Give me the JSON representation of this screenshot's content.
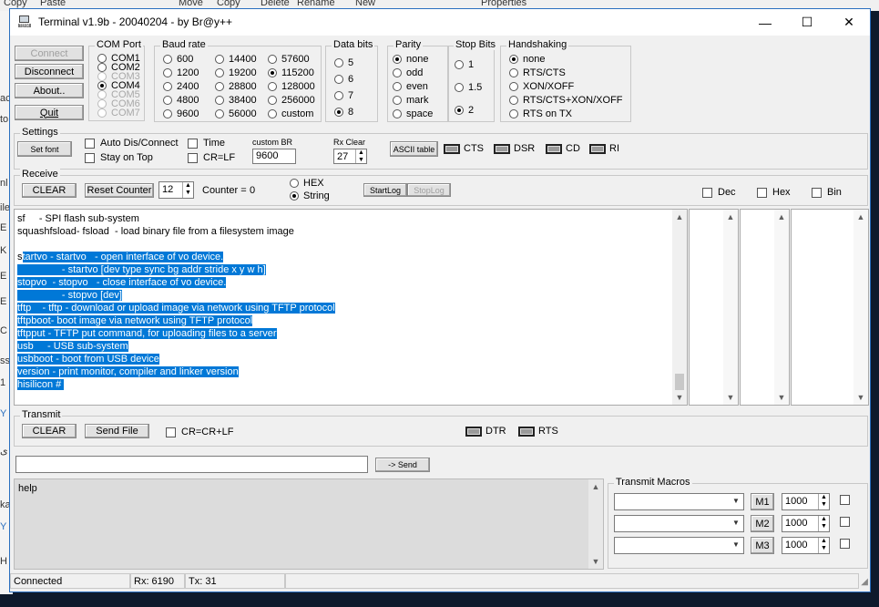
{
  "background": {
    "explorer_labels": [
      "Copy",
      "Paste",
      "Move",
      "Copy",
      "Delete",
      "Rename",
      "New",
      "Properties"
    ],
    "left_labels": [
      "ac",
      "to",
      "nl",
      "ile",
      "E",
      "K",
      "E",
      "E",
      "C",
      "ss",
      "1",
      "Y",
      "ى",
      "ka",
      "Y",
      "H"
    ]
  },
  "window": {
    "title": "Terminal v1.9b - 20040204 - by Br@y++",
    "controls": {
      "minimize": "—",
      "maximize": "☐",
      "close": "✕"
    }
  },
  "left_buttons": {
    "connect": "Connect",
    "disconnect": "Disconnect",
    "about": "About..",
    "quit": "Quit"
  },
  "com_port": {
    "label": "COM Port",
    "options": [
      "COM1",
      "COM2",
      "COM3",
      "COM4",
      "COM5",
      "COM6",
      "COM7"
    ],
    "selected": "COM4"
  },
  "baud_rate": {
    "label": "Baud rate",
    "col1": [
      "600",
      "1200",
      "2400",
      "4800",
      "9600"
    ],
    "col2": [
      "14400",
      "19200",
      "28800",
      "38400",
      "56000"
    ],
    "col3": [
      "57600",
      "115200",
      "128000",
      "256000",
      "custom"
    ],
    "selected": "115200"
  },
  "data_bits": {
    "label": "Data bits",
    "options": [
      "5",
      "6",
      "7",
      "8"
    ],
    "selected": "8"
  },
  "parity": {
    "label": "Parity",
    "options": [
      "none",
      "odd",
      "even",
      "mark",
      "space"
    ],
    "selected": "none"
  },
  "stop_bits": {
    "label": "Stop Bits",
    "options": [
      "1",
      "1.5",
      "2"
    ],
    "selected": "2"
  },
  "handshaking": {
    "label": "Handshaking",
    "options": [
      "none",
      "RTS/CTS",
      "XON/XOFF",
      "RTS/CTS+XON/XOFF",
      "RTS on TX"
    ],
    "selected": "none"
  },
  "settings": {
    "label": "Settings",
    "set_font": "Set font",
    "auto_dis": "Auto Dis/Connect",
    "stay_on_top": "Stay on Top",
    "time": "Time",
    "crlf": "CR=LF",
    "custom_br_label": "custom BR",
    "custom_br_value": "9600",
    "rx_clear_label": "Rx Clear",
    "rx_clear_value": "27",
    "ascii_table": "ASCII table",
    "leds": [
      "CTS",
      "DSR",
      "CD",
      "RI"
    ]
  },
  "receive": {
    "label": "Receive",
    "clear": "CLEAR",
    "reset_counter": "Reset Counter",
    "counter_spin": "12",
    "counter_label": "Counter = ",
    "counter_value": "0",
    "hex": "HEX",
    "string": "String",
    "start_log": "StartLog",
    "stop_log": "StopLog",
    "dec": "Dec",
    "hex2": "Hex",
    "bin": "Bin",
    "lines": [
      {
        "pre": "sf     - SPI flash sub-system",
        "sel": ""
      },
      {
        "pre": "squashfsload- fsload  - load binary file from a filesystem image",
        "sel": ""
      },
      {
        "pre": "",
        "sel": ""
      },
      {
        "pre": "s",
        "sel": "tartvo - startvo   - open interface of vo device."
      },
      {
        "pre": "",
        "sel": "                - startvo [dev type sync bg addr stride x y w h]"
      },
      {
        "pre": "",
        "sel": "stopvo  - stopvo   - close interface of vo device."
      },
      {
        "pre": "",
        "sel": "                - stopvo [dev]"
      },
      {
        "pre": "",
        "sel": "tftp    - tftp - download or upload image via network using TFTP protocol"
      },
      {
        "pre": "",
        "sel": "tftpboot- boot image via network using TFTP protocol"
      },
      {
        "pre": "",
        "sel": "tftpput - TFTP put command, for uploading files to a server"
      },
      {
        "pre": "",
        "sel": "usb     - USB sub-system"
      },
      {
        "pre": "",
        "sel": "usbboot - boot from USB device"
      },
      {
        "pre": "",
        "sel": "version - print monitor, compiler and linker version"
      },
      {
        "pre": "",
        "sel": "hisilicon # "
      }
    ]
  },
  "transmit": {
    "label": "Transmit",
    "clear": "CLEAR",
    "send_file": "Send File",
    "cr_crlf": "CR=CR+LF",
    "dtr": "DTR",
    "rts": "RTS",
    "input_value": "",
    "send": "-> Send",
    "history": [
      "help"
    ]
  },
  "macros": {
    "label": "Transmit Macros",
    "rows": [
      {
        "button": "M1",
        "delay": "1000"
      },
      {
        "button": "M2",
        "delay": "1000"
      },
      {
        "button": "M3",
        "delay": "1000"
      }
    ]
  },
  "status": {
    "connection": "Connected",
    "rx": "Rx: 6190",
    "tx": "Tx: 31"
  }
}
